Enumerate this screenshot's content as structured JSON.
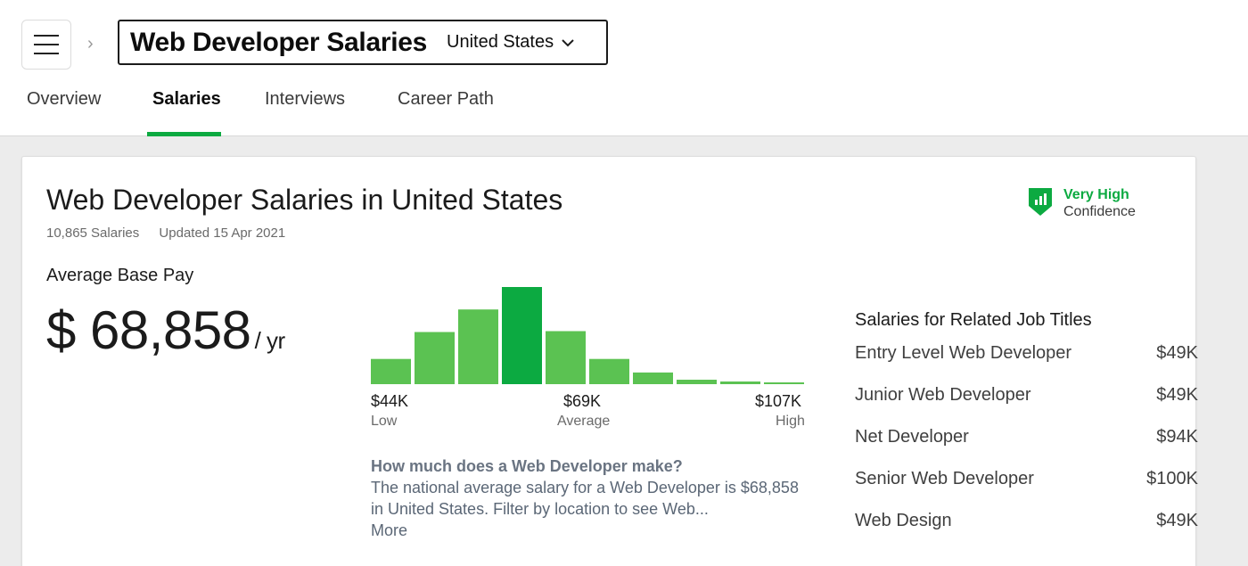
{
  "header": {
    "title": "Web Developer Salaries",
    "location": "United States",
    "tabs": [
      {
        "label": "Overview"
      },
      {
        "label": "Salaries"
      },
      {
        "label": "Interviews"
      },
      {
        "label": "Career Path"
      }
    ],
    "active_tab": "Salaries"
  },
  "card": {
    "heading": "Web Developer Salaries in United States",
    "salaries_count": "10,865 Salaries",
    "updated": "Updated 15 Apr 2021",
    "confidence_level": "Very High",
    "confidence_label": "Confidence",
    "avg_label": "Average Base Pay",
    "avg_value": "$ 68,858",
    "avg_unit": "/ yr",
    "low_value": "$44K",
    "low_label": "Low",
    "average_value": "$69K",
    "average_label": "Average",
    "high_value": "$107K",
    "high_label": "High",
    "question_title": "How much does a Web Developer make?",
    "question_body": "The national average salary for a Web Developer is $68,858 in United States. Filter by location to see Web...",
    "more_label": "More"
  },
  "related": {
    "title": "Salaries for Related Job Titles",
    "items": [
      {
        "title": "Entry Level Web Developer",
        "salary": "$49K"
      },
      {
        "title": "Junior Web Developer",
        "salary": "$49K"
      },
      {
        "title": "Net Developer",
        "salary": "$94K"
      },
      {
        "title": "Senior Web Developer",
        "salary": "$100K"
      },
      {
        "title": "Web Design",
        "salary": "$49K"
      }
    ]
  },
  "colors": {
    "accent": "#0caa41",
    "bar": "#5bc252",
    "bar_highlight": "#0caa41"
  },
  "chart_data": {
    "type": "bar",
    "values": [
      28,
      58,
      83,
      108,
      59,
      28,
      13,
      5,
      3,
      2
    ],
    "highlight_index": 3
  }
}
